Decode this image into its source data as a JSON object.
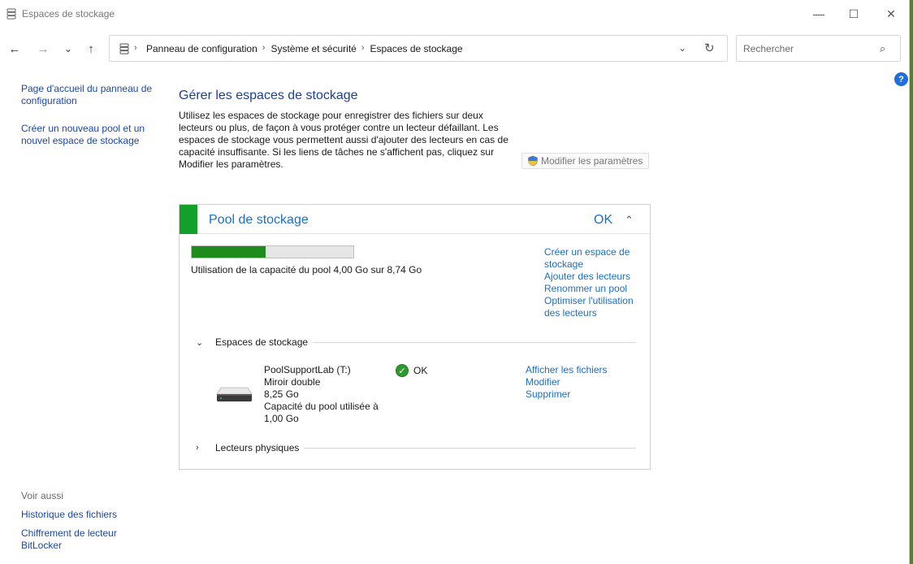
{
  "window": {
    "title": "Espaces de stockage",
    "minimize_glyph": "—",
    "maximize_glyph": "☐",
    "close_glyph": "✕"
  },
  "nav": {
    "back_glyph": "←",
    "forward_glyph": "→",
    "recent_glyph": "⌄",
    "up_glyph": "↑",
    "breadcrumbs": [
      "Panneau de configuration",
      "Système et sécurité",
      "Espaces de stockage"
    ],
    "dropdown_glyph": "⌄",
    "refresh_glyph": "↻"
  },
  "search": {
    "placeholder": "Rechercher"
  },
  "help": {
    "glyph": "?"
  },
  "leftpane": {
    "links": [
      "Page d'accueil du panneau de configuration",
      "Créer un nouveau pool et un nouvel espace de stockage"
    ],
    "see_also_label": "Voir aussi",
    "see_also_links": [
      "Historique des fichiers",
      "Chiffrement de lecteur BitLocker"
    ]
  },
  "main": {
    "title": "Gérer les espaces de stockage",
    "description": "Utilisez les espaces de stockage pour enregistrer des fichiers sur deux lecteurs ou plus, de façon à vous protéger contre un lecteur défaillant. Les espaces de stockage vous permettent aussi d'ajouter des lecteurs en cas de capacité insuffisante. Si les liens de tâches ne s'affichent pas, cliquez sur Modifier les paramètres.",
    "modify_button": "Modifier les paramètres"
  },
  "pool": {
    "title": "Pool de stockage",
    "status": "OK",
    "collapse_glyph": "⌃",
    "capacity_text": "Utilisation de la capacité du pool 4,00 Go sur 8,74 Go",
    "capacity_fraction": 0.458,
    "actions": [
      "Créer un espace de stockage",
      "Ajouter des lecteurs",
      "Renommer un pool",
      "Optimiser l'utilisation des lecteurs"
    ],
    "spaces_section": {
      "label": "Espaces de stockage",
      "chevron": "⌄"
    },
    "space": {
      "name": "PoolSupportLab (T:)",
      "resiliency": "Miroir double",
      "size": "8,25 Go",
      "pool_used": "Capacité du pool utilisée à 1,00 Go",
      "status": "OK",
      "status_glyph": "✓",
      "actions": [
        "Afficher les fichiers",
        "Modifier",
        "Supprimer"
      ]
    },
    "physical_section": {
      "label": "Lecteurs physiques",
      "chevron": "›"
    }
  }
}
